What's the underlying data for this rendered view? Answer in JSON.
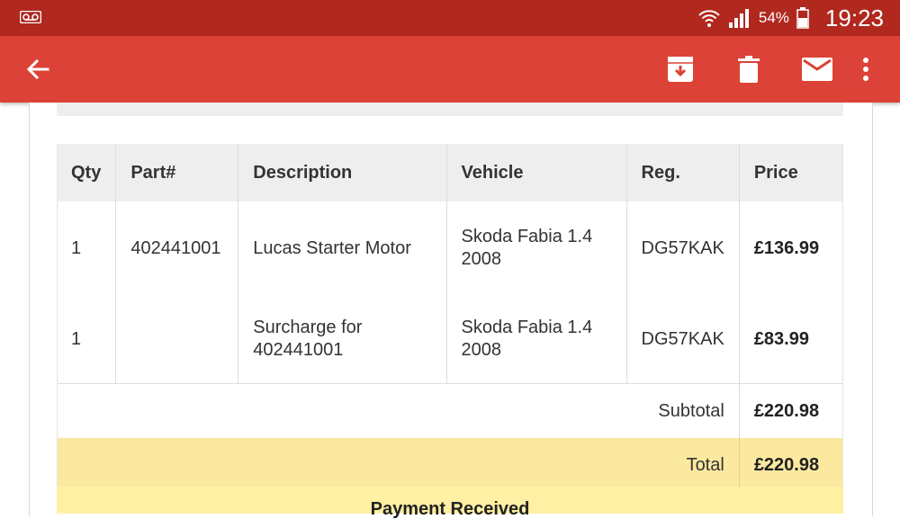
{
  "status_bar": {
    "battery_percent": "54%",
    "time": "19:23",
    "icons": [
      "voicemail-icon",
      "wifi-icon",
      "signal-icon",
      "battery-icon"
    ]
  },
  "app_bar": {
    "icons": [
      "back-arrow-icon",
      "archive-icon",
      "delete-icon",
      "mail-icon",
      "more-vert-icon"
    ]
  },
  "order_table": {
    "headers": {
      "qty": "Qty",
      "part": "Part#",
      "description": "Description",
      "vehicle": "Vehicle",
      "reg": "Reg.",
      "price": "Price"
    },
    "rows": [
      {
        "qty": "1",
        "part": "402441001",
        "description": "Lucas Starter Motor",
        "vehicle": "Skoda Fabia 1.4 2008",
        "reg": "DG57KAK",
        "price": "£136.99"
      },
      {
        "qty": "1",
        "part": "",
        "description": "Surcharge for 402441001",
        "vehicle": "Skoda Fabia 1.4 2008",
        "reg": "DG57KAK",
        "price": "£83.99"
      }
    ],
    "subtotal_label": "Subtotal",
    "subtotal_value": "£220.98",
    "total_label": "Total",
    "total_value": "£220.98"
  },
  "payment_notice": "Payment Received",
  "colors": {
    "status_bar": "#b0281e",
    "app_bar": "#dc4237",
    "header_bg": "#eeeeee",
    "total_bg": "#fbe9a0"
  }
}
